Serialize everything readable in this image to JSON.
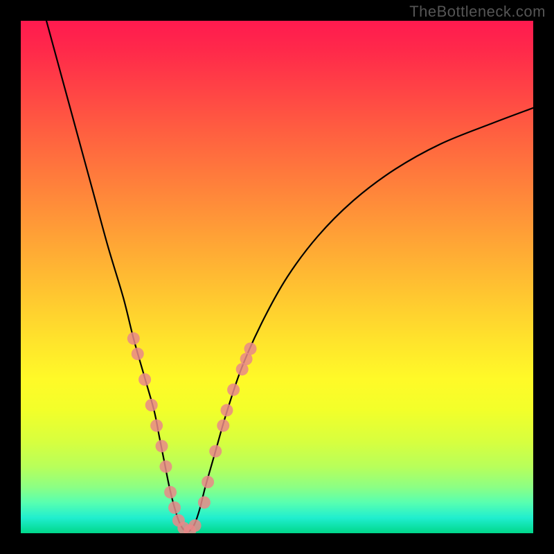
{
  "watermark": "TheBottleneck.com",
  "chart_data": {
    "type": "line",
    "title": "",
    "xlabel": "",
    "ylabel": "",
    "xlim": [
      0,
      100
    ],
    "ylim": [
      0,
      100
    ],
    "annotations": [
      "TheBottleneck.com"
    ],
    "series": [
      {
        "name": "bottleneck-curve",
        "x": [
          5,
          8,
          11,
          14,
          17,
          20,
          22,
          24,
          26,
          27,
          28,
          29,
          30,
          31,
          32,
          33,
          34,
          35,
          36,
          38,
          40,
          43,
          47,
          52,
          58,
          65,
          73,
          82,
          92,
          100
        ],
        "y": [
          100,
          89,
          78,
          67,
          56,
          46,
          38,
          31,
          24,
          19,
          14,
          9,
          5,
          2,
          0.5,
          0.5,
          2,
          5,
          9,
          16,
          23,
          32,
          41,
          50,
          58,
          65,
          71,
          76,
          80,
          83
        ]
      }
    ],
    "markers": {
      "name": "highlight-points",
      "color": "#e98888",
      "points": [
        {
          "x": 22.0,
          "y": 38
        },
        {
          "x": 22.8,
          "y": 35
        },
        {
          "x": 24.2,
          "y": 30
        },
        {
          "x": 25.5,
          "y": 25
        },
        {
          "x": 26.5,
          "y": 21
        },
        {
          "x": 27.5,
          "y": 17
        },
        {
          "x": 28.3,
          "y": 13
        },
        {
          "x": 29.2,
          "y": 8
        },
        {
          "x": 30.0,
          "y": 5
        },
        {
          "x": 30.8,
          "y": 2.5
        },
        {
          "x": 31.8,
          "y": 1
        },
        {
          "x": 33.0,
          "y": 0.5
        },
        {
          "x": 34.0,
          "y": 1.5
        },
        {
          "x": 35.8,
          "y": 6
        },
        {
          "x": 36.5,
          "y": 10
        },
        {
          "x": 38.0,
          "y": 16
        },
        {
          "x": 39.5,
          "y": 21
        },
        {
          "x": 40.2,
          "y": 24
        },
        {
          "x": 41.5,
          "y": 28
        },
        {
          "x": 43.2,
          "y": 32
        },
        {
          "x": 44.0,
          "y": 34
        },
        {
          "x": 44.8,
          "y": 36
        }
      ]
    }
  }
}
